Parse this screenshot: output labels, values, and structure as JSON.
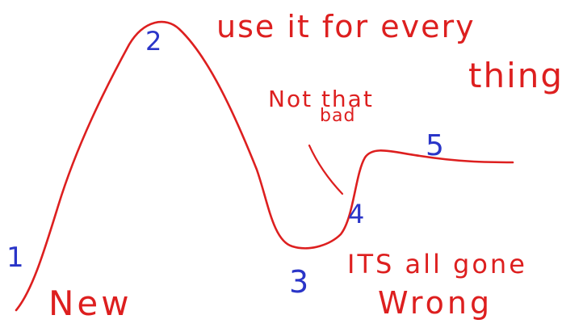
{
  "colors": {
    "background": "#ffffff",
    "curve": "#dd1f1f",
    "annotation_red": "#dd1f1f",
    "annotation_blue": "#2a35c8"
  },
  "stages": [
    {
      "number": "1"
    },
    {
      "number": "2"
    },
    {
      "number": "3"
    },
    {
      "number": "4"
    },
    {
      "number": "5"
    }
  ],
  "annotations": {
    "stage1": "New",
    "stage2_line1": "use it for every",
    "stage2_line2": "thing",
    "stage3_line1": "ITS all gone",
    "stage3_line2": "Wrong",
    "stage4_line1": "Not that",
    "stage4_line2": "bad"
  }
}
